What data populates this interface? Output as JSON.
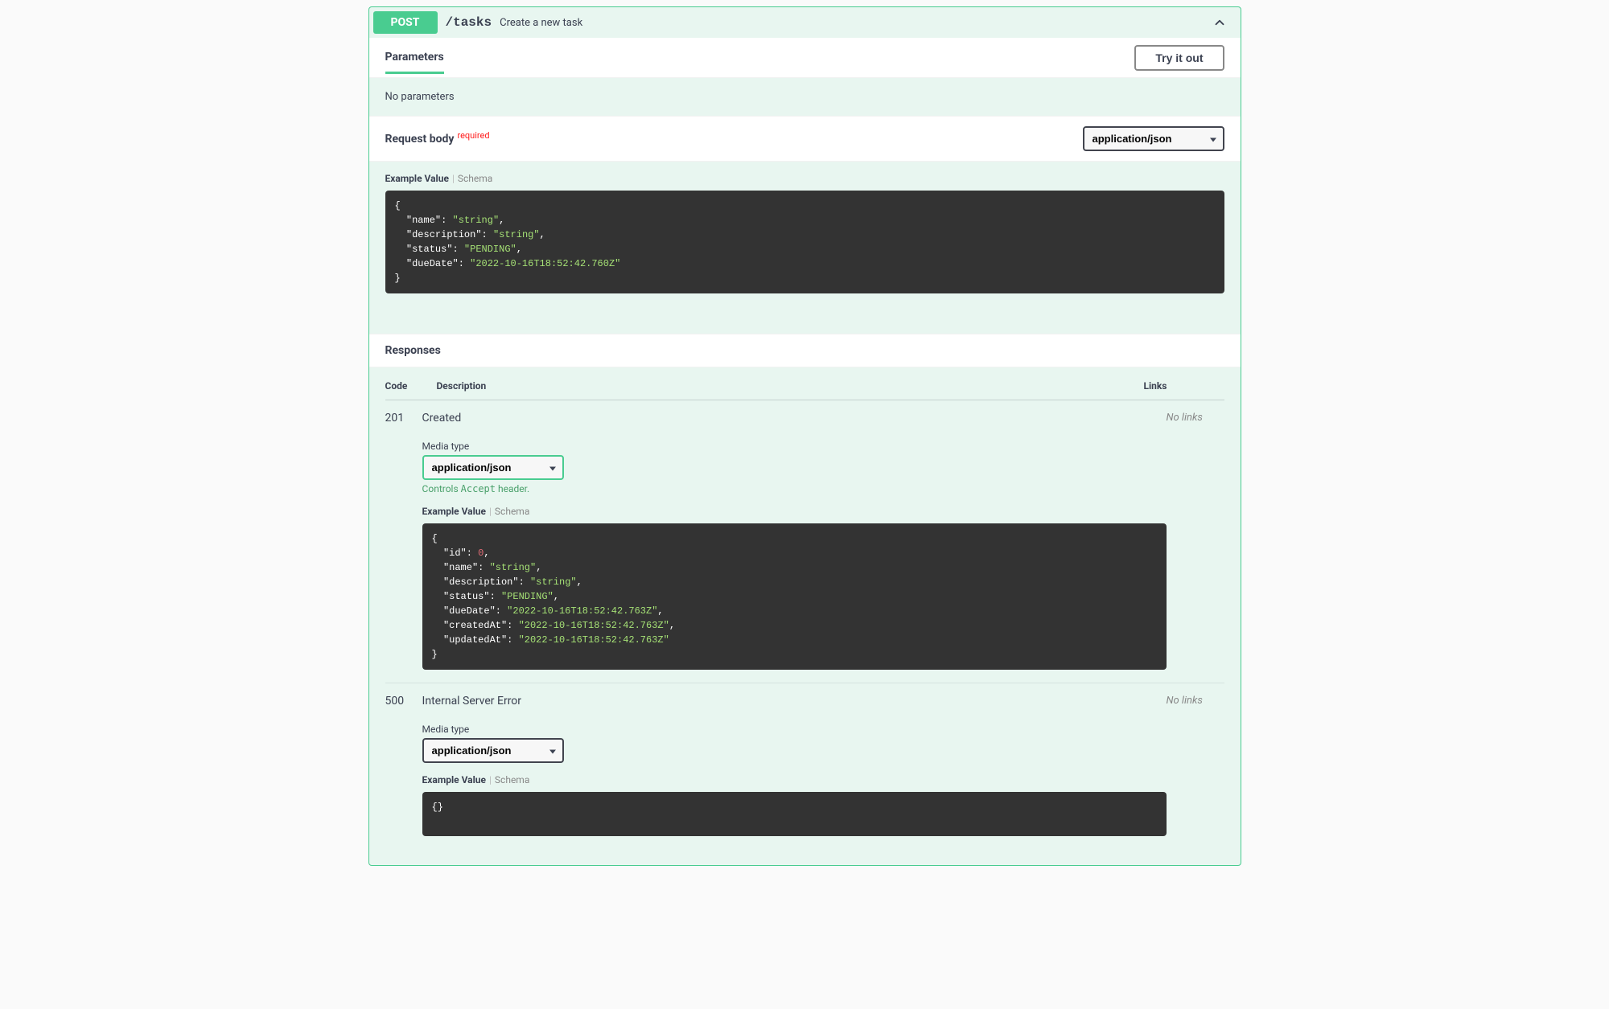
{
  "operation": {
    "method": "POST",
    "path": "/tasks",
    "summary": "Create a new task"
  },
  "parameters": {
    "tab_label": "Parameters",
    "try_button": "Try it out",
    "empty_text": "No parameters"
  },
  "request_body": {
    "title": "Request body",
    "required_text": "required",
    "content_type": "application/json",
    "example_tab": "Example Value",
    "schema_tab": "Schema",
    "example": {
      "fields": [
        {
          "key": "name",
          "type": "str",
          "value": "string"
        },
        {
          "key": "description",
          "type": "str",
          "value": "string"
        },
        {
          "key": "status",
          "type": "str",
          "value": "PENDING"
        },
        {
          "key": "dueDate",
          "type": "str",
          "value": "2022-10-16T18:52:42.760Z"
        }
      ]
    }
  },
  "responses": {
    "title": "Responses",
    "col_code": "Code",
    "col_desc": "Description",
    "col_links": "Links",
    "media_type_label": "Media type",
    "accept_note_pre": "Controls ",
    "accept_note_code": "Accept",
    "accept_note_post": " header.",
    "example_tab": "Example Value",
    "schema_tab": "Schema",
    "rows": [
      {
        "code": "201",
        "description": "Created",
        "links": "No links",
        "content_type": "application/json",
        "select_variant": "green",
        "show_accept_note": true,
        "example": {
          "fields": [
            {
              "key": "id",
              "type": "num",
              "value": "0"
            },
            {
              "key": "name",
              "type": "str",
              "value": "string"
            },
            {
              "key": "description",
              "type": "str",
              "value": "string"
            },
            {
              "key": "status",
              "type": "str",
              "value": "PENDING"
            },
            {
              "key": "dueDate",
              "type": "str",
              "value": "2022-10-16T18:52:42.763Z"
            },
            {
              "key": "createdAt",
              "type": "str",
              "value": "2022-10-16T18:52:42.763Z"
            },
            {
              "key": "updatedAt",
              "type": "str",
              "value": "2022-10-16T18:52:42.763Z"
            }
          ]
        }
      },
      {
        "code": "500",
        "description": "Internal Server Error",
        "links": "No links",
        "content_type": "application/json",
        "select_variant": "plain",
        "show_accept_note": false,
        "example": {
          "fields": []
        }
      }
    ]
  }
}
